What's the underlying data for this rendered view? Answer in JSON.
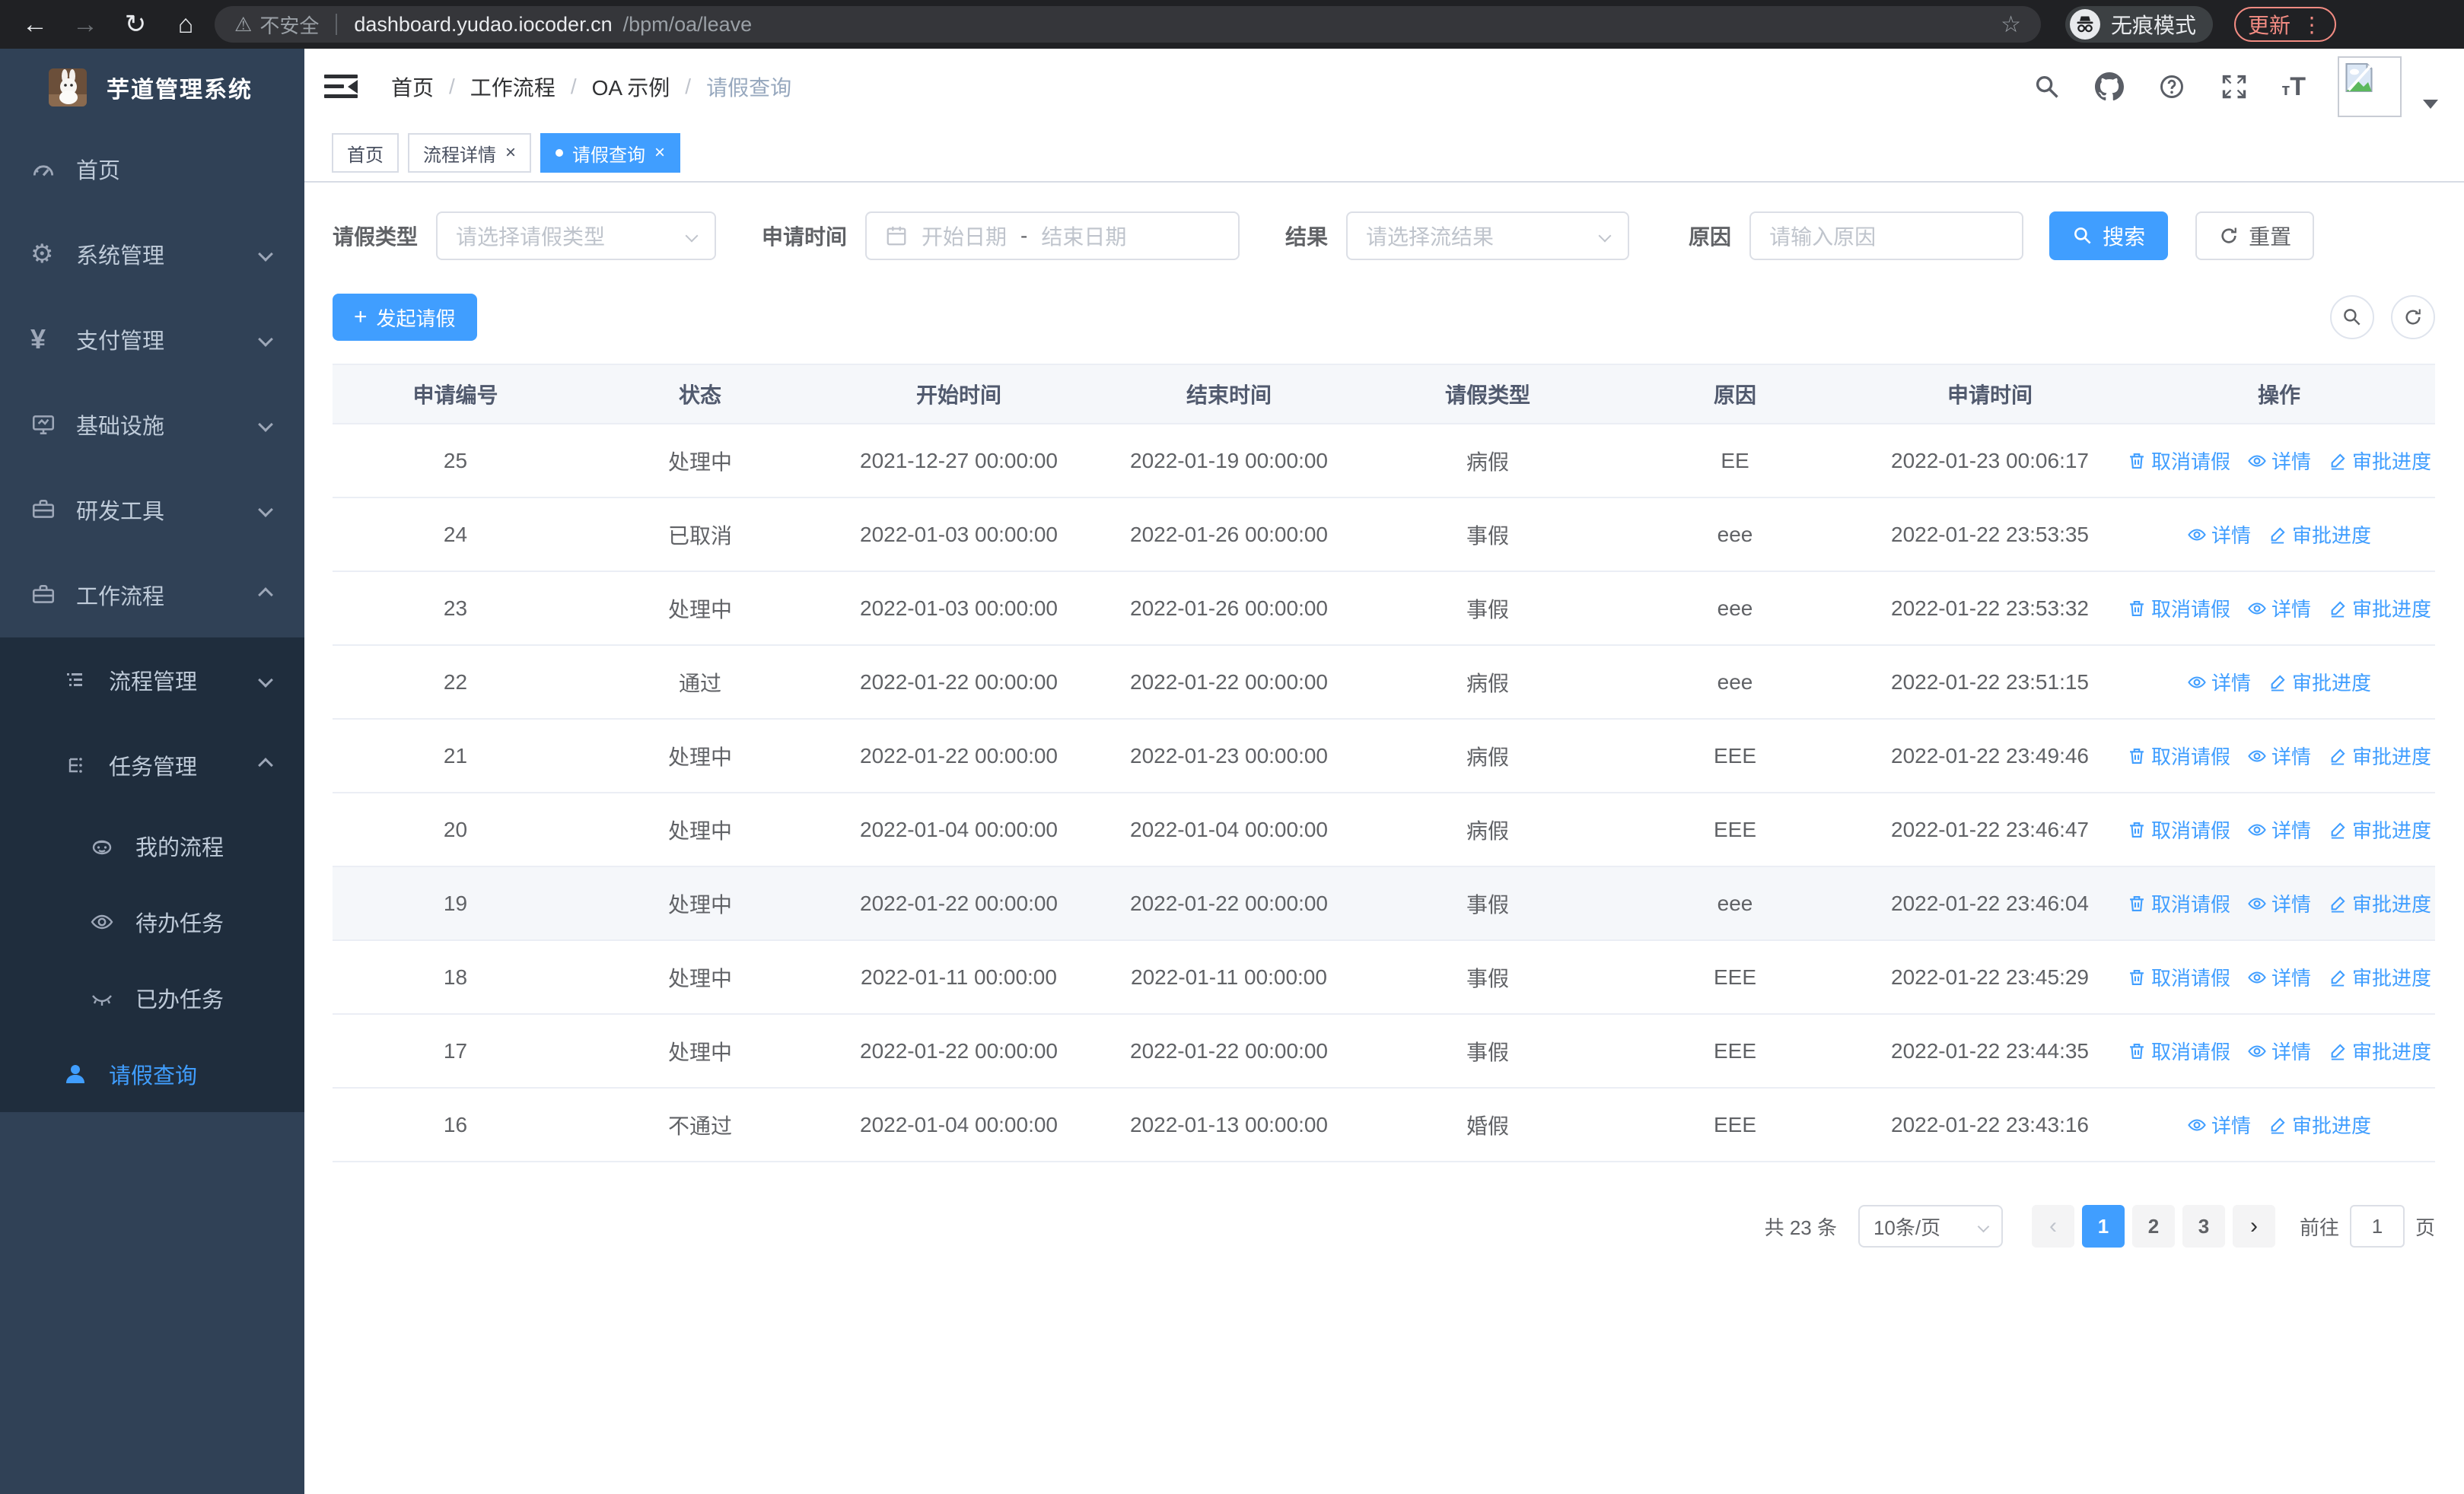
{
  "browser": {
    "not_secure": "不安全",
    "url_domain": "dashboard.yudao.iocoder.cn",
    "url_path": "/bpm/oa/leave",
    "incognito_label": "无痕模式",
    "update_label": "更新"
  },
  "sidebar": {
    "title": "芋道管理系统",
    "menu": [
      {
        "label": "首页"
      },
      {
        "label": "系统管理"
      },
      {
        "label": "支付管理"
      },
      {
        "label": "基础设施"
      },
      {
        "label": "研发工具"
      },
      {
        "label": "工作流程"
      }
    ],
    "submenu": [
      {
        "label": "流程管理"
      },
      {
        "label": "任务管理"
      },
      {
        "label": "我的流程"
      },
      {
        "label": "待办任务"
      },
      {
        "label": "已办任务"
      },
      {
        "label": "请假查询"
      }
    ]
  },
  "header": {
    "breadcrumb": [
      "首页",
      "工作流程",
      "OA 示例",
      "请假查询"
    ]
  },
  "tabs": [
    {
      "label": "首页"
    },
    {
      "label": "流程详情"
    },
    {
      "label": "请假查询"
    }
  ],
  "filters": {
    "type_label": "请假类型",
    "type_placeholder": "请选择请假类型",
    "time_label": "申请时间",
    "start_placeholder": "开始日期",
    "range_separator": "-",
    "end_placeholder": "结束日期",
    "result_label": "结果",
    "result_placeholder": "请选择流结果",
    "reason_label": "原因",
    "reason_placeholder": "请输入原因",
    "search_label": "搜索",
    "reset_label": "重置"
  },
  "toolbar": {
    "create_label": "发起请假"
  },
  "table": {
    "headers": [
      "申请编号",
      "状态",
      "开始时间",
      "结束时间",
      "请假类型",
      "原因",
      "申请时间",
      "操作"
    ],
    "action_labels": {
      "cancel": "取消请假",
      "detail": "详情",
      "progress": "审批进度"
    },
    "rows": [
      {
        "id": "25",
        "status": "处理中",
        "start": "2021-12-27 00:00:00",
        "end": "2022-01-19 00:00:00",
        "type": "病假",
        "reason": "EE",
        "applied": "2022-01-23 00:06:17",
        "can_cancel": true,
        "highlight": false
      },
      {
        "id": "24",
        "status": "已取消",
        "start": "2022-01-03 00:00:00",
        "end": "2022-01-26 00:00:00",
        "type": "事假",
        "reason": "eee",
        "applied": "2022-01-22 23:53:35",
        "can_cancel": false,
        "highlight": false
      },
      {
        "id": "23",
        "status": "处理中",
        "start": "2022-01-03 00:00:00",
        "end": "2022-01-26 00:00:00",
        "type": "事假",
        "reason": "eee",
        "applied": "2022-01-22 23:53:32",
        "can_cancel": true,
        "highlight": false
      },
      {
        "id": "22",
        "status": "通过",
        "start": "2022-01-22 00:00:00",
        "end": "2022-01-22 00:00:00",
        "type": "病假",
        "reason": "eee",
        "applied": "2022-01-22 23:51:15",
        "can_cancel": false,
        "highlight": false
      },
      {
        "id": "21",
        "status": "处理中",
        "start": "2022-01-22 00:00:00",
        "end": "2022-01-23 00:00:00",
        "type": "病假",
        "reason": "EEE",
        "applied": "2022-01-22 23:49:46",
        "can_cancel": true,
        "highlight": false
      },
      {
        "id": "20",
        "status": "处理中",
        "start": "2022-01-04 00:00:00",
        "end": "2022-01-04 00:00:00",
        "type": "病假",
        "reason": "EEE",
        "applied": "2022-01-22 23:46:47",
        "can_cancel": true,
        "highlight": false
      },
      {
        "id": "19",
        "status": "处理中",
        "start": "2022-01-22 00:00:00",
        "end": "2022-01-22 00:00:00",
        "type": "事假",
        "reason": "eee",
        "applied": "2022-01-22 23:46:04",
        "can_cancel": true,
        "highlight": true
      },
      {
        "id": "18",
        "status": "处理中",
        "start": "2022-01-11 00:00:00",
        "end": "2022-01-11 00:00:00",
        "type": "事假",
        "reason": "EEE",
        "applied": "2022-01-22 23:45:29",
        "can_cancel": true,
        "highlight": false
      },
      {
        "id": "17",
        "status": "处理中",
        "start": "2022-01-22 00:00:00",
        "end": "2022-01-22 00:00:00",
        "type": "事假",
        "reason": "EEE",
        "applied": "2022-01-22 23:44:35",
        "can_cancel": true,
        "highlight": false
      },
      {
        "id": "16",
        "status": "不通过",
        "start": "2022-01-04 00:00:00",
        "end": "2022-01-13 00:00:00",
        "type": "婚假",
        "reason": "EEE",
        "applied": "2022-01-22 23:43:16",
        "can_cancel": false,
        "highlight": false
      }
    ]
  },
  "pagination": {
    "total": "共 23 条",
    "page_size": "10条/页",
    "pages": [
      "1",
      "2",
      "3"
    ],
    "active_page": "1",
    "goto_label": "前往",
    "goto_value": "1",
    "page_unit": "页"
  },
  "colors": {
    "accent": "#409eff",
    "sidebar_bg": "#304156",
    "submenu_bg": "#1f2d3d",
    "update_badge": "#f28b82"
  }
}
